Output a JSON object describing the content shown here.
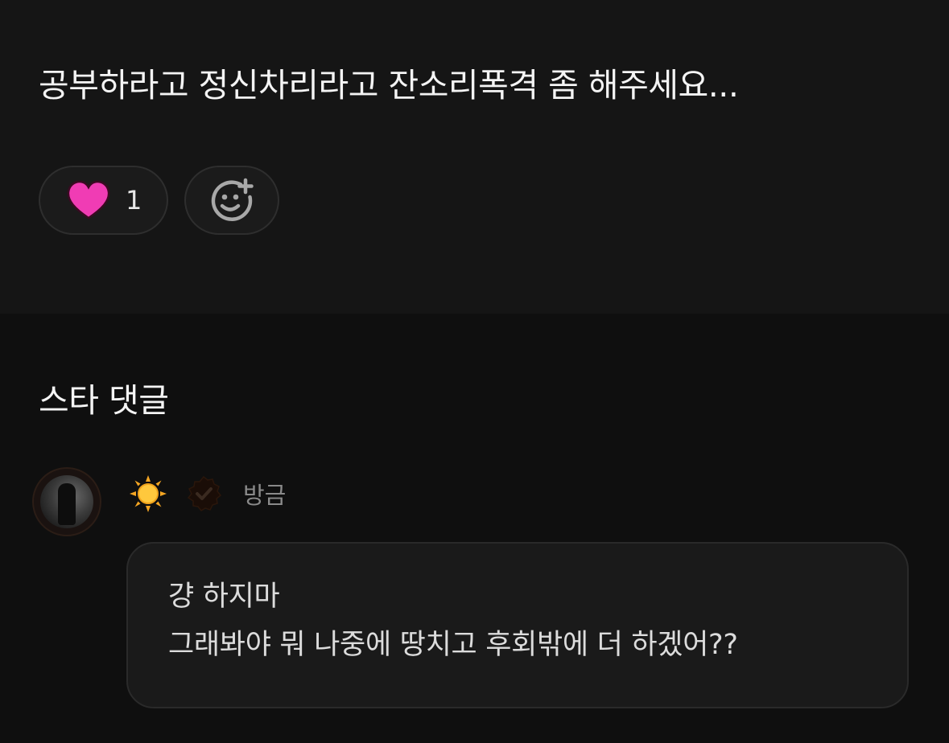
{
  "post": {
    "text": "공부하라고 정신차리라고 잔소리폭격 좀 해주세요...",
    "like_count": "1",
    "icons": {
      "like": "heart-icon",
      "add_reaction": "add-emoji-icon"
    },
    "colors": {
      "heart": "#f03cb4"
    }
  },
  "comments_section": {
    "title": "스타 댓글",
    "comment": {
      "author_emoji": "sun-icon",
      "verified_badge": "verified-badge-icon",
      "timestamp": "방금",
      "lines": [
        "걍 하지마",
        "그래봐야 뭐 나중에 땅치고 후회밖에 더 하겠어??"
      ]
    }
  }
}
